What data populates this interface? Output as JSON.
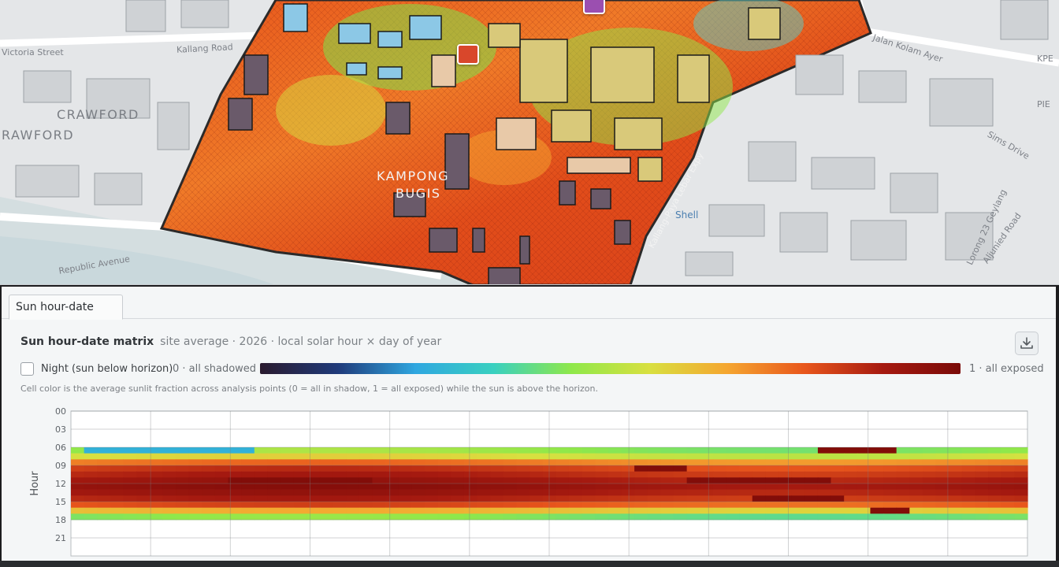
{
  "map": {
    "districts": [
      "CRAWFORD",
      "RAWFORD",
      "KAMPONG",
      "BUGIS"
    ],
    "roads": [
      "Kallang Road",
      "Victoria Street",
      "Republic Avenue",
      "Jalan Kolam Ayer",
      "Sims Drive",
      "Lorong 23 Geylang",
      "Aljunied Road",
      "Kallang-Paya Lebar Expy",
      "KPE",
      "PIE"
    ],
    "poi": "Shell",
    "markers": [
      {
        "color": "#d9472b"
      },
      {
        "color": "#9b4fb0"
      }
    ]
  },
  "panel": {
    "tab_label": "Sun hour-date",
    "title": "Sun hour-date matrix",
    "subtitle": "site average · 2026 · local solar hour × day of year",
    "download_icon": "download-icon",
    "night_label": "Night (sun below horizon)",
    "legend_min": "0 · all shadowed",
    "legend_max": "1 · all exposed",
    "note": "Cell color is the average sunlit fraction across analysis points (0 = all in shadow, 1 = all exposed) while the sun is above the horizon.",
    "colors": {
      "colormap": [
        "#2a1a2e",
        "#1f3a7a",
        "#2fa7e0",
        "#39d0c0",
        "#8fe84a",
        "#d8e040",
        "#f5a630",
        "#e8561c",
        "#a61a10",
        "#7a0a08"
      ]
    }
  },
  "chart_data": {
    "type": "heatmap",
    "xlabel": "",
    "ylabel": "Hour",
    "y_ticks": [
      "00",
      "03",
      "06",
      "09",
      "12",
      "15",
      "18",
      "21"
    ],
    "x_range_days": [
      1,
      365
    ],
    "y_range_hours": [
      0,
      24
    ],
    "sun_hours": [
      6,
      18
    ],
    "hour_profile": [
      {
        "hour": 6,
        "value": 0.45
      },
      {
        "hour": 7,
        "value": 0.55
      },
      {
        "hour": 8,
        "value": 0.72
      },
      {
        "hour": 9,
        "value": 0.82
      },
      {
        "hour": 10,
        "value": 0.86
      },
      {
        "hour": 11,
        "value": 0.9
      },
      {
        "hour": 12,
        "value": 0.93
      },
      {
        "hour": 13,
        "value": 0.9
      },
      {
        "hour": 14,
        "value": 0.86
      },
      {
        "hour": 15,
        "value": 0.78
      },
      {
        "hour": 16,
        "value": 0.62
      },
      {
        "hour": 17,
        "value": 0.42
      }
    ],
    "anomalies": [
      {
        "day_start": 3,
        "day_end": 70,
        "hour": 6,
        "value": 0.25
      },
      {
        "day_start": 282,
        "day_end": 315,
        "hour": 6,
        "value": 0.98
      },
      {
        "day_start": 215,
        "day_end": 235,
        "hour": 9,
        "value": 0.98
      },
      {
        "day_start": 58,
        "day_end": 113,
        "hour": 11,
        "value": 0.98
      },
      {
        "day_start": 233,
        "day_end": 290,
        "hour": 11,
        "value": 0.98
      },
      {
        "day_start": 260,
        "day_end": 294,
        "hour": 14,
        "value": 0.98
      },
      {
        "day_start": 304,
        "day_end": 318,
        "hour": 16,
        "value": 0.98
      }
    ]
  }
}
